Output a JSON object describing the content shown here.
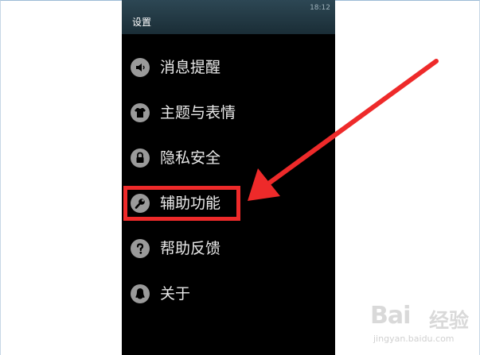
{
  "status_bar": {
    "time": "18:12"
  },
  "header": {
    "title": "设置"
  },
  "menu": {
    "items": [
      {
        "label": "消息提醒",
        "icon": "speaker-icon"
      },
      {
        "label": "主题与表情",
        "icon": "shirt-icon"
      },
      {
        "label": "隐私安全",
        "icon": "lock-icon"
      },
      {
        "label": "辅助功能",
        "icon": "wrench-icon"
      },
      {
        "label": "帮助反馈",
        "icon": "question-icon"
      },
      {
        "label": "关于",
        "icon": "penguin-icon"
      }
    ]
  },
  "annotation": {
    "color": "#ee2a2a",
    "highlighted_item": "辅助功能"
  },
  "watermark": {
    "logo": "Bai",
    "logo_tail": "经验",
    "url": "jingyan.baidu.com"
  }
}
